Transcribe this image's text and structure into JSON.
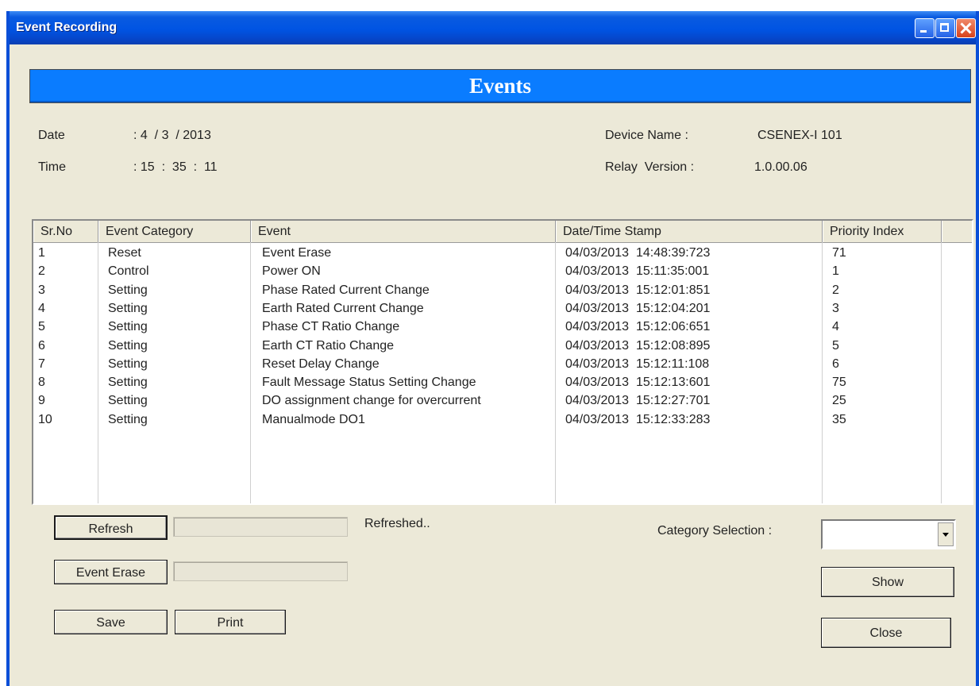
{
  "window": {
    "title": "Event Recording"
  },
  "banner": {
    "title": "Events"
  },
  "info": {
    "date_label": "Date",
    "date_value": ": 4  / 3  / 2013",
    "time_label": "Time",
    "time_value": ": 15  :  35  :  11",
    "device_label": "Device Name :",
    "device_value": "CSENEX-I 101",
    "version_label": "Relay  Version :",
    "version_value": "1.0.00.06"
  },
  "table": {
    "columns": [
      "Sr.No",
      "Event Category",
      "Event",
      "Date/Time Stamp",
      "Priority Index"
    ],
    "rows": [
      [
        "1",
        "Reset",
        "Event Erase",
        "04/03/2013  14:48:39:723",
        "71"
      ],
      [
        "2",
        "Control",
        "Power ON",
        "04/03/2013  15:11:35:001",
        "1"
      ],
      [
        "3",
        "Setting",
        "Phase Rated Current Change",
        "04/03/2013  15:12:01:851",
        "2"
      ],
      [
        "4",
        "Setting",
        "Earth Rated Current Change",
        "04/03/2013  15:12:04:201",
        "3"
      ],
      [
        "5",
        "Setting",
        "Phase CT Ratio Change",
        "04/03/2013  15:12:06:651",
        "4"
      ],
      [
        "6",
        "Setting",
        "Earth CT Ratio Change",
        "04/03/2013  15:12:08:895",
        "5"
      ],
      [
        "7",
        "Setting",
        "Reset Delay Change",
        "04/03/2013  15:12:11:108",
        "6"
      ],
      [
        "8",
        "Setting",
        "Fault Message Status Setting Change",
        "04/03/2013  15:12:13:601",
        "75"
      ],
      [
        "9",
        "Setting",
        "DO assignment change for overcurrent",
        "04/03/2013  15:12:27:701",
        "25"
      ],
      [
        "10",
        "Setting",
        "Manualmode DO1",
        "04/03/2013  15:12:33:283",
        "35"
      ]
    ]
  },
  "controls": {
    "refresh_label": "Refresh",
    "refresh_status": "Refreshed..",
    "erase_label": "Event Erase",
    "save_label": "Save",
    "print_label": "Print",
    "category_label": "Category Selection :",
    "category_value": "",
    "show_label": "Show",
    "close_label": "Close"
  }
}
